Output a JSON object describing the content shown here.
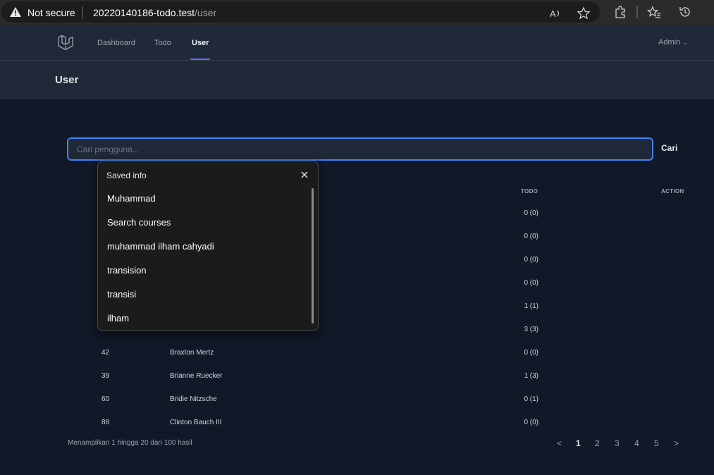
{
  "browser": {
    "security_label": "Not secure",
    "url_host": "20220140186-todo.test",
    "url_path": "/user",
    "icons": [
      "read-aloud-icon",
      "favorite-star-icon",
      "extensions-icon",
      "favorites-icon",
      "history-icon"
    ]
  },
  "nav": {
    "links": [
      {
        "label": "Dashboard"
      },
      {
        "label": "Todo"
      },
      {
        "label": "User"
      }
    ],
    "active": "User",
    "user_menu": "Admin",
    "accent_color": "#6366f1"
  },
  "page": {
    "title": "User"
  },
  "search": {
    "placeholder": "Cari pengguna...",
    "button_label": "Cari"
  },
  "table": {
    "headers": {
      "todo": "TODO",
      "action": "ACTION"
    },
    "rows": [
      {
        "id": "",
        "name": "",
        "todo": "0 (0)"
      },
      {
        "id": "",
        "name": "",
        "todo": "0 (0)"
      },
      {
        "id": "",
        "name": "",
        "todo": "0 (0)"
      },
      {
        "id": "",
        "name": "",
        "todo": "0 (0)"
      },
      {
        "id": "",
        "name": "",
        "todo": "1 (1)"
      },
      {
        "id": "",
        "name": "",
        "todo": "3 (3)"
      },
      {
        "id": "42",
        "name": "Braxton Mertz",
        "todo": "0 (0)"
      },
      {
        "id": "39",
        "name": "Brianne Ruecker",
        "todo": "1 (3)"
      },
      {
        "id": "60",
        "name": "Bridie Nitzsche",
        "todo": "0 (1)"
      },
      {
        "id": "88",
        "name": "Clinton Bauch III",
        "todo": "0 (0)"
      }
    ]
  },
  "pagination": {
    "summary": "Menampilkan 1 hingga 20 dari 100 hasil",
    "prev": "<",
    "pages": [
      "1",
      "2",
      "3",
      "4",
      "5"
    ],
    "current": "1",
    "next": ">"
  },
  "saved_info": {
    "title": "Saved info",
    "items": [
      "Muhammad",
      "Search courses",
      "muhammad ilham cahyadi",
      "transision",
      "transisi",
      "ilham"
    ]
  }
}
